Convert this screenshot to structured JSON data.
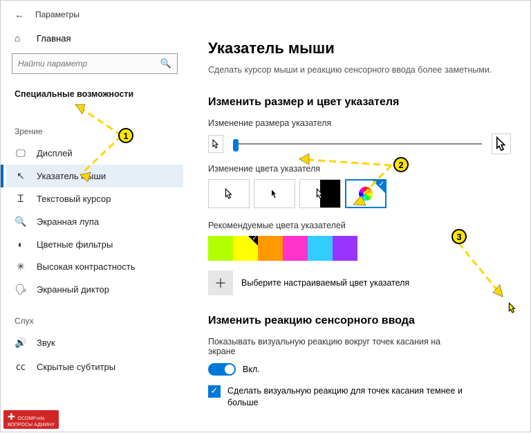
{
  "topbar": {
    "title": "Параметры"
  },
  "sidebar": {
    "home": "Главная",
    "search_placeholder": "Найти параметр",
    "category": "Специальные возможности",
    "group_vision": "Зрение",
    "group_hearing": "Слух",
    "items_vision": [
      {
        "label": "Дисплей"
      },
      {
        "label": "Указатель мыши"
      },
      {
        "label": "Текстовый курсор"
      },
      {
        "label": "Экранная лупа"
      },
      {
        "label": "Цветные фильтры"
      },
      {
        "label": "Высокая контрастность"
      },
      {
        "label": "Экранный диктор"
      }
    ],
    "items_hearing": [
      {
        "label": "Звук"
      },
      {
        "label": "Скрытые субтитры"
      }
    ]
  },
  "main": {
    "title": "Указатель мыши",
    "description": "Сделать курсор мыши и реакцию сенсорного ввода более заметными.",
    "section_size": "Изменить размер и цвет указателя",
    "size_label": "Изменение размера указателя",
    "color_label": "Изменение цвета указателя",
    "recommended_label": "Рекомендуемые цвета указателей",
    "recommended_colors": [
      "#b3ff00",
      "#ffff00",
      "#ff9900",
      "#ff33cc",
      "#33ccff",
      "#9933ff"
    ],
    "recommended_selected_index": 1,
    "custom_label": "Выберите настраиваемый цвет указателя",
    "section_touch": "Изменить реакцию сенсорного ввода",
    "touch_desc": "Показывать визуальную реакцию вокруг точек касания на экране",
    "toggle_state": "Вкл.",
    "darker_label": "Сделать визуальную реакцию для точек касания темнее и больше"
  },
  "watermark": {
    "line1": "OCOMP.info",
    "line2": "ВОПРОСЫ АДМИНУ"
  },
  "badges": [
    "1",
    "2",
    "3"
  ]
}
